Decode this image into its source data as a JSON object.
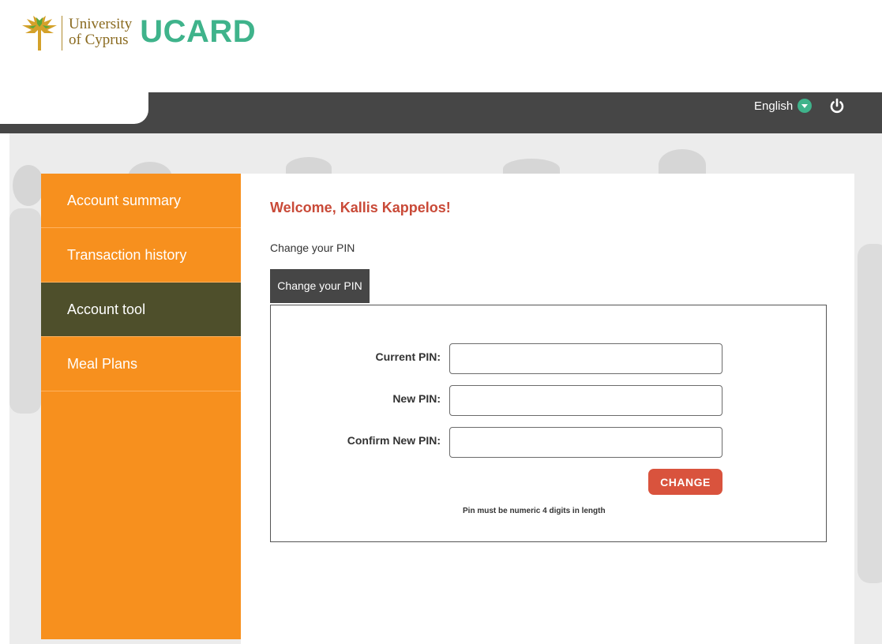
{
  "header": {
    "logo_university": "University",
    "logo_of_cyprus": "of Cyprus",
    "logo_ucard": "UCARD",
    "language": "English"
  },
  "sidebar": {
    "items": [
      {
        "label": "Account summary"
      },
      {
        "label": "Transaction history"
      },
      {
        "label": "Account tool"
      },
      {
        "label": "Meal Plans"
      }
    ]
  },
  "main": {
    "welcome": "Welcome, Kallis Kappelos!",
    "section_title": "Change your PIN",
    "tab_label": "Change your PIN",
    "form": {
      "current_pin_label": "Current PIN:",
      "new_pin_label": "New PIN:",
      "confirm_pin_label": "Confirm New PIN:",
      "current_pin_value": "",
      "new_pin_value": "",
      "confirm_pin_value": "",
      "submit_label": "CHANGE",
      "hint": "Pin must be numeric 4 digits in length"
    }
  },
  "colors": {
    "accent_green": "#3fb38b",
    "sidebar_orange": "#f7901e",
    "active_olive": "#4e4f2b",
    "topbar_dark": "#464646",
    "welcome_red": "#c94a38",
    "button_red": "#d9533d"
  },
  "icons": {
    "logo": "tree-logo-icon",
    "language_dropdown": "chevron-down-icon",
    "logout": "power-icon",
    "active_indicator": "arrow-right-icon"
  }
}
